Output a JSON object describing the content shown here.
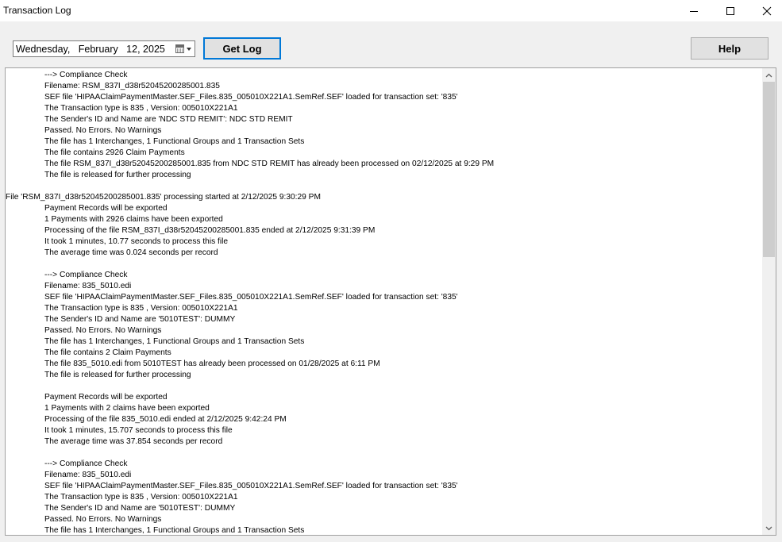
{
  "window": {
    "title": "Transaction Log",
    "controls": [
      "minimize-icon",
      "maximize-icon",
      "close-icon"
    ]
  },
  "toolbar": {
    "date_value": "Wednesday,   February   12, 2025",
    "calendar_icon": "calendar-icon",
    "get_log_label": "Get Log",
    "help_label": "Help",
    "accent_color": "#0078d7"
  },
  "log": {
    "lines": [
      {
        "indent": 1,
        "text": "---> Compliance Check"
      },
      {
        "indent": 1,
        "text": "Filename: RSM_837I_d38r52045200285001.835"
      },
      {
        "indent": 1,
        "text": "SEF file 'HIPAAClaimPaymentMaster.SEF_Files.835_005010X221A1.SemRef.SEF' loaded for transaction set: '835'"
      },
      {
        "indent": 1,
        "text": "The Transaction type is 835 , Version: 005010X221A1"
      },
      {
        "indent": 1,
        "text": "The Sender's ID and Name are 'NDC STD REMIT': NDC STD REMIT"
      },
      {
        "indent": 1,
        "text": "Passed. No Errors. No Warnings"
      },
      {
        "indent": 1,
        "text": "The file has 1 Interchanges, 1 Functional Groups and 1 Transaction Sets"
      },
      {
        "indent": 1,
        "text": "The file contains 2926 Claim Payments"
      },
      {
        "indent": 1,
        "text": "The file RSM_837I_d38r52045200285001.835 from NDC STD REMIT has already been processed on 02/12/2025 at 9:29 PM"
      },
      {
        "indent": 1,
        "text": "The file is released for further processing"
      },
      {
        "indent": 1,
        "text": ""
      },
      {
        "indent": 0,
        "text": "File 'RSM_837I_d38r52045200285001.835' processing started at 2/12/2025 9:30:29 PM"
      },
      {
        "indent": 1,
        "text": "Payment Records will be exported"
      },
      {
        "indent": 1,
        "text": "1 Payments with 2926 claims have been exported"
      },
      {
        "indent": 1,
        "text": "Processing of the file RSM_837I_d38r52045200285001.835 ended at 2/12/2025 9:31:39 PM"
      },
      {
        "indent": 1,
        "text": "It took 1 minutes, 10.77 seconds to process this file"
      },
      {
        "indent": 1,
        "text": "The average time was 0.024 seconds per record"
      },
      {
        "indent": 1,
        "text": ""
      },
      {
        "indent": 1,
        "text": "---> Compliance Check"
      },
      {
        "indent": 1,
        "text": "Filename: 835_5010.edi"
      },
      {
        "indent": 1,
        "text": "SEF file 'HIPAAClaimPaymentMaster.SEF_Files.835_005010X221A1.SemRef.SEF' loaded for transaction set: '835'"
      },
      {
        "indent": 1,
        "text": "The Transaction type is 835 , Version: 005010X221A1"
      },
      {
        "indent": 1,
        "text": "The Sender's ID and Name are '5010TEST': DUMMY"
      },
      {
        "indent": 1,
        "text": "Passed. No Errors. No Warnings"
      },
      {
        "indent": 1,
        "text": "The file has 1 Interchanges, 1 Functional Groups and 1 Transaction Sets"
      },
      {
        "indent": 1,
        "text": "The file contains 2 Claim Payments"
      },
      {
        "indent": 1,
        "text": "The file 835_5010.edi from 5010TEST has already been processed on 01/28/2025 at 6:11 PM"
      },
      {
        "indent": 1,
        "text": "The file is released for further processing"
      },
      {
        "indent": 1,
        "text": ""
      },
      {
        "indent": 1,
        "text": "Payment Records will be exported"
      },
      {
        "indent": 1,
        "text": "1 Payments with 2 claims have been exported"
      },
      {
        "indent": 1,
        "text": "Processing of the file 835_5010.edi ended at 2/12/2025 9:42:24 PM"
      },
      {
        "indent": 1,
        "text": "It took 1 minutes, 15.707 seconds to process this file"
      },
      {
        "indent": 1,
        "text": "The average time was 37.854 seconds per record"
      },
      {
        "indent": 1,
        "text": ""
      },
      {
        "indent": 1,
        "text": "---> Compliance Check"
      },
      {
        "indent": 1,
        "text": "Filename: 835_5010.edi"
      },
      {
        "indent": 1,
        "text": "SEF file 'HIPAAClaimPaymentMaster.SEF_Files.835_005010X221A1.SemRef.SEF' loaded for transaction set: '835'"
      },
      {
        "indent": 1,
        "text": "The Transaction type is 835 , Version: 005010X221A1"
      },
      {
        "indent": 1,
        "text": "The Sender's ID and Name are '5010TEST': DUMMY"
      },
      {
        "indent": 1,
        "text": "Passed. No Errors. No Warnings"
      },
      {
        "indent": 1,
        "text": "The file has 1 Interchanges, 1 Functional Groups and 1 Transaction Sets"
      }
    ]
  },
  "scrollbar": {
    "up_icon": "chevron-up-icon",
    "down_icon": "chevron-down-icon"
  }
}
